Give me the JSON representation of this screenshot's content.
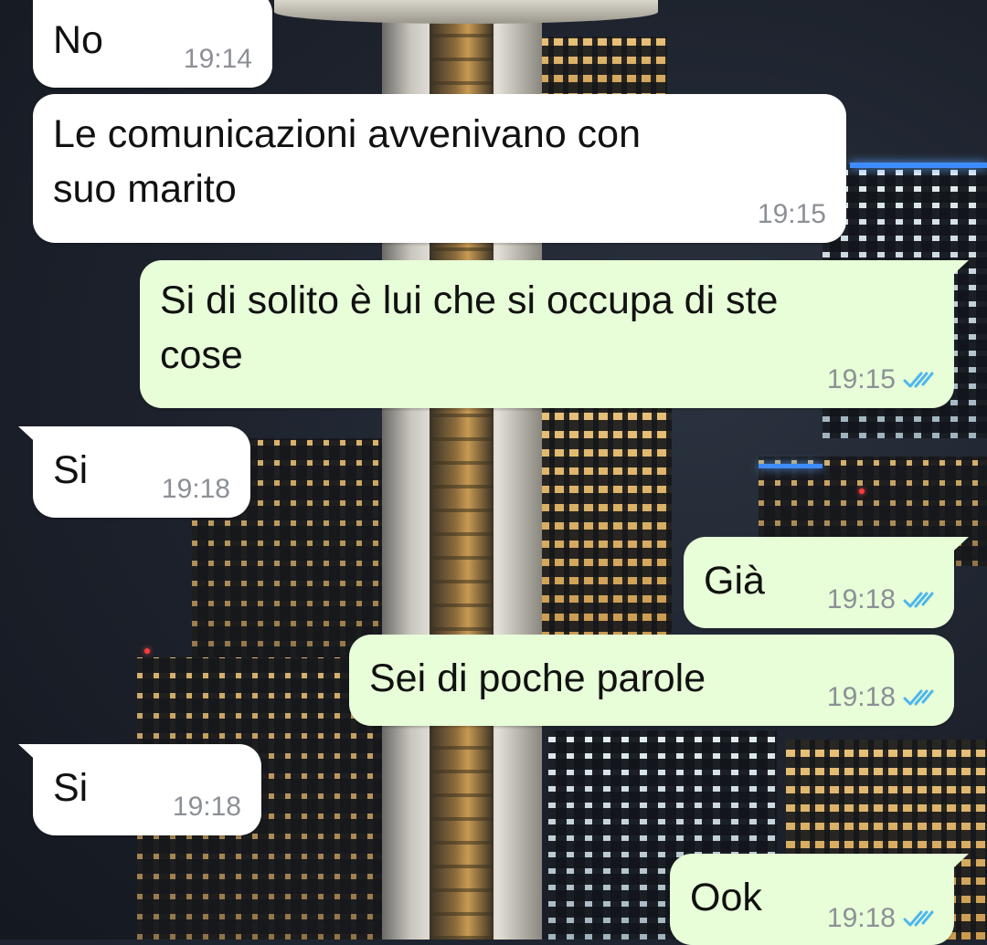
{
  "colors": {
    "incoming_bubble": "#ffffff",
    "outgoing_bubble": "#e7fed8",
    "timestamp": "#8c9096",
    "read_ticks": "#4fb6ec"
  },
  "icons": {
    "read_receipt": "double-check-icon"
  },
  "messages": [
    {
      "direction": "incoming",
      "text": "No",
      "time": "19:14"
    },
    {
      "direction": "incoming",
      "text": "Le comunicazioni avvenivano con\nsuo marito",
      "time": "19:15"
    },
    {
      "direction": "outgoing",
      "text": "Si di solito è lui che si occupa di ste\ncose",
      "time": "19:15",
      "status": "read"
    },
    {
      "direction": "incoming",
      "text": "Si",
      "time": "19:18"
    },
    {
      "direction": "outgoing",
      "text": "Già",
      "time": "19:18",
      "status": "read"
    },
    {
      "direction": "outgoing",
      "text": "Sei di poche parole",
      "time": "19:18",
      "status": "read"
    },
    {
      "direction": "incoming",
      "text": "Si",
      "time": "19:18"
    },
    {
      "direction": "outgoing",
      "text": "Ook",
      "time": "19:18",
      "status": "read"
    }
  ]
}
